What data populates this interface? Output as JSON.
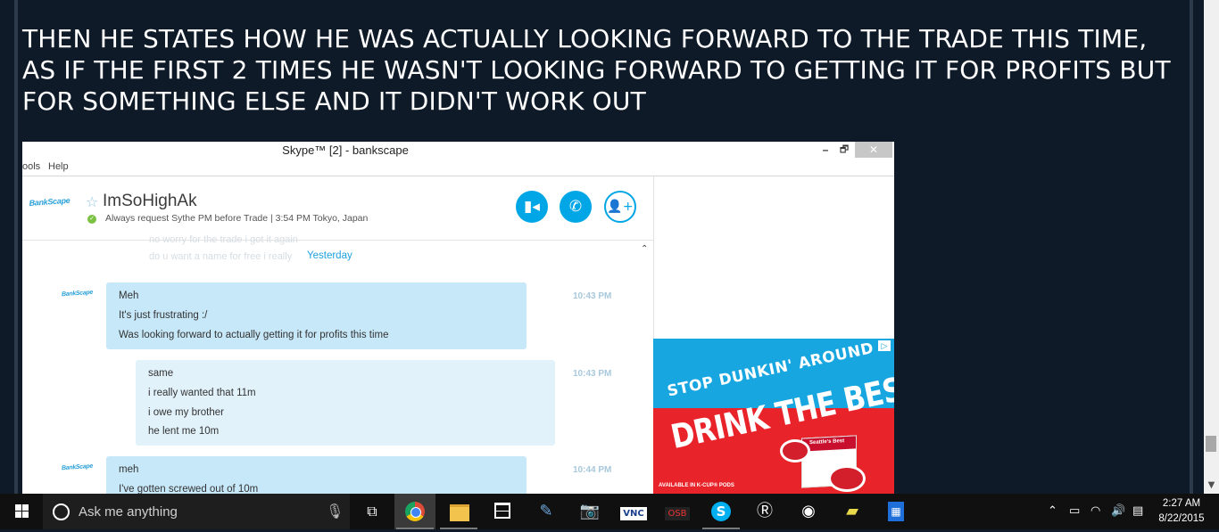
{
  "headline": "THEN HE STATES HOW HE WAS ACTUALLY LOOKING FORWARD TO THE TRADE THIS TIME, AS IF THE FIRST 2 TIMES HE WASN'T LOOKING FORWARD TO GETTING IT FOR PROFITS BUT FOR SOMETHING ELSE AND IT DIDN'T WORK OUT",
  "skype": {
    "window_title": "Skype™ [2] - bankscape",
    "window_controls": {
      "minimize": "–",
      "maximize": "🗗",
      "close": "✕"
    },
    "menu": [
      "ools",
      "Help"
    ],
    "contact": {
      "avatar_text": "BankScape",
      "name": "ImSoHighAk",
      "mood": "Always request Sythe PM before Trade | 3:54 PM Tokyo, Japan",
      "status": "online"
    },
    "actions": {
      "video_icon": "video-call-icon",
      "call_icon": "phone-call-icon",
      "add_icon": "add-contact-icon"
    },
    "earlier": {
      "faded_line_1": "no worry for the trade i got it again",
      "faded_line_2": "do u want a name for free i really",
      "day_label": "Yesterday"
    },
    "messages": [
      {
        "from": "contact",
        "avatar_text": "BankScape",
        "lines": [
          "Meh",
          "It's just frustrating :/",
          "Was looking forward to actually getting it for profits this time"
        ],
        "time": "10:43 PM"
      },
      {
        "from": "me",
        "lines": [
          "same",
          "i really wanted that 11m",
          "i owe my brother",
          "he lent me 10m"
        ],
        "time": "10:43 PM"
      },
      {
        "from": "contact",
        "avatar_text": "BankScape",
        "lines": [
          "meh",
          "I've gotten screwed out of 10m"
        ],
        "time": "10:44 PM"
      }
    ],
    "ad": {
      "line1": "STOP DUNKIN' AROUND",
      "line2": "DRINK THE BEST",
      "footer": "AVAILABLE IN K-CUP® PODS",
      "box_label": "Seattle's Best",
      "colors": {
        "top": "#18a6e0",
        "bottom": "#e8242a"
      }
    }
  },
  "taskbar": {
    "search_placeholder": "Ask me anything",
    "apps": [
      "task-view",
      "chrome",
      "file-explorer",
      "store",
      "paint",
      "camera",
      "vnc",
      "osb",
      "skype",
      "runelite",
      "steam",
      "folder-yellow",
      "calculator"
    ],
    "vnc_label": "VNC",
    "osb_label": "OSB",
    "clock_time": "2:27 AM",
    "clock_date": "8/22/2015"
  }
}
